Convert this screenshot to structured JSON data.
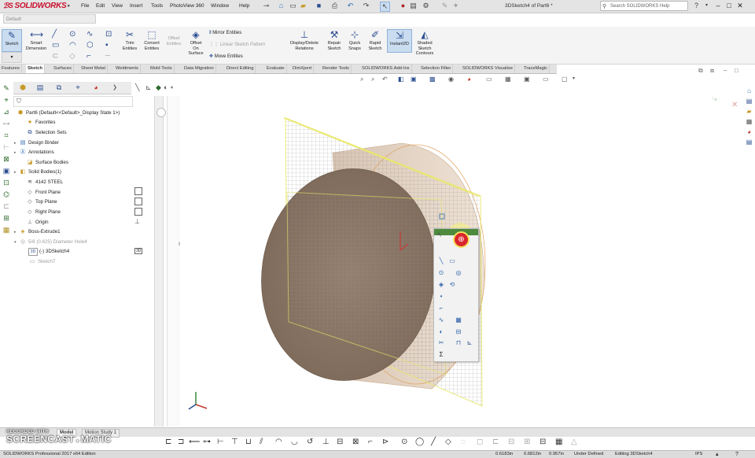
{
  "app": {
    "logo_text": "SOLIDWORKS",
    "logo_prefix": "ℬS",
    "menus": [
      "File",
      "Edit",
      "View",
      "Insert",
      "Tools",
      "PhotoView 360",
      "Window",
      "Help"
    ],
    "document_title": "3DSketch4 of Part6 *",
    "help_search_placeholder": "Search SOLIDWORKS Help",
    "configuration": "Default"
  },
  "ribbon": {
    "sketch": "Sketch",
    "smart_dimension": [
      "Smart",
      "Dimension"
    ],
    "trim_entities": [
      "Trim",
      "Entities"
    ],
    "convert_entities": [
      "Convert",
      "Entities"
    ],
    "offset_entities": [
      "Offset",
      "Entities"
    ],
    "offset_on_surface": [
      "Offset",
      "On",
      "Surface"
    ],
    "mirror_entities": "Mirror Entities",
    "linear_sketch_pattern": "Linear Sketch Pattern",
    "move_entities": "Move Entities",
    "display_delete_relations": [
      "Display/Delete",
      "Relations"
    ],
    "repair_sketch": [
      "Repair",
      "Sketch"
    ],
    "quick_snaps": [
      "Quick",
      "Snaps"
    ],
    "rapid_sketch": [
      "Rapid",
      "Sketch"
    ],
    "instant2d": "Instant2D",
    "shaded_sketch_contours": [
      "Shaded",
      "Sketch",
      "Contours"
    ]
  },
  "tabs": [
    "Features",
    "Sketch",
    "Surfaces",
    "Sheet Metal",
    "Weldments",
    "Mold Tools",
    "Data Migration",
    "Direct Editing",
    "Evaluate",
    "DimXpert",
    "Render Tools",
    "SOLIDWORKS Add-Ins",
    "Selection Filter",
    "SOLIDWORKS Visualize",
    "TraceMagic"
  ],
  "active_tab": "Sketch",
  "feature_tree": {
    "root": "Part6  (Default<<Default>_Display State 1>)",
    "items": [
      {
        "label": "Favorites",
        "icon": "star-icon"
      },
      {
        "label": "Selection Sets",
        "icon": "selection-sets-icon"
      },
      {
        "label": "Design Binder",
        "icon": "binder-icon"
      },
      {
        "label": "Annotations",
        "icon": "annotations-icon"
      },
      {
        "label": "Surface Bodies",
        "icon": "surface-bodies-icon"
      },
      {
        "label": "Solid Bodies(1)",
        "icon": "solid-bodies-icon"
      },
      {
        "label": "4142 STEEL",
        "icon": "material-icon"
      },
      {
        "label": "Front Plane",
        "icon": "plane-icon"
      },
      {
        "label": "Top Plane",
        "icon": "plane-icon"
      },
      {
        "label": "Right Plane",
        "icon": "plane-icon"
      },
      {
        "label": "Origin",
        "icon": "origin-icon"
      },
      {
        "label": "Boss-Extrude1",
        "icon": "extrude-icon"
      },
      {
        "label": "5/8 (0.625) Diameter Hole4",
        "icon": "hole-icon"
      },
      {
        "label": "(-) 3DSketch4",
        "icon": "3dsketch-icon"
      },
      {
        "label": "Sketch7",
        "icon": "sketch-icon"
      }
    ]
  },
  "bottom_tabs": [
    "Model",
    "Motion Study 1"
  ],
  "active_bottom_tab": "Model",
  "status": {
    "edition": "SOLIDWORKS Professional 2017 x64 Edition",
    "x": "0.6183in",
    "y": "0.6812in",
    "z": "0.957in",
    "definition": "Under Defined",
    "editing": "Editing 3DSketch4",
    "units": "IPS"
  },
  "watermark": {
    "line1": "RECORDED WITH",
    "line2": "SCREENCAST",
    "line3": "MATIC"
  },
  "colors": {
    "brand_red": "#c8102e",
    "cylinder_face": "#8a7565",
    "sketch_grid": "#9a9a9a",
    "sketch_outline": "#e8e86a",
    "context_header": "#4d8a3d"
  }
}
